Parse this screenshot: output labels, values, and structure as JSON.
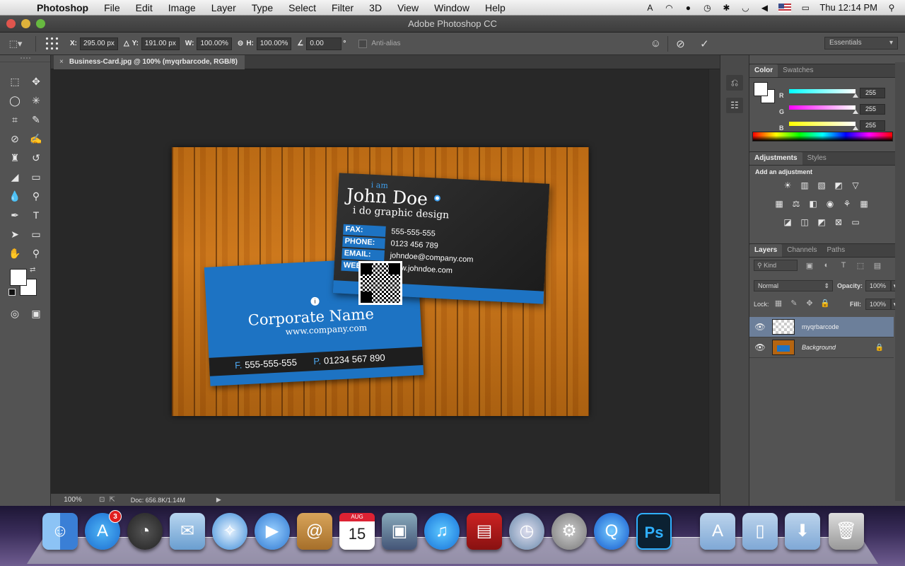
{
  "menubar": {
    "app": "Photoshop",
    "items": [
      "File",
      "Edit",
      "Image",
      "Layer",
      "Type",
      "Select",
      "Filter",
      "3D",
      "View",
      "Window",
      "Help"
    ],
    "clock": "Thu 12:14 PM"
  },
  "window": {
    "title": "Adobe Photoshop CC"
  },
  "options": {
    "x_label": "X:",
    "x_value": "295.00 px",
    "y_label": "Y:",
    "y_value": "191.00 px",
    "w_label": "W:",
    "w_value": "100.00%",
    "h_label": "H:",
    "h_value": "100.00%",
    "angle_value": "0.00",
    "degree": "°",
    "antialias": "Anti-alias",
    "workspace": "Essentials"
  },
  "document": {
    "tab": "Business-Card.jpg @ 100% (myqrbarcode, RGB/8)",
    "zoom": "100%",
    "doc_size": "Doc: 656.8K/1.14M"
  },
  "card_dark": {
    "iam": "i am",
    "name": "John Doe",
    "subtitle": "i do graphic design",
    "rows": [
      {
        "label": "FAX:",
        "value": "555-555-555"
      },
      {
        "label": "PHONE:",
        "value": "0123 456 789"
      },
      {
        "label": "EMAIL:",
        "value": "johndoe@company.com"
      },
      {
        "label": "WEB:",
        "value": "www.johndoe.com"
      }
    ]
  },
  "card_blue": {
    "info": "i",
    "name": "Corporate Name",
    "url": "www.company.com",
    "fax_key": "F.",
    "fax": "555-555-555",
    "phone_key": "P.",
    "phone": "01234 567 890"
  },
  "color_panel": {
    "tabs": [
      "Color",
      "Swatches"
    ],
    "r_label": "R",
    "r": "255",
    "g_label": "G",
    "g": "255",
    "b_label": "B",
    "b": "255"
  },
  "adjust_panel": {
    "tabs": [
      "Adjustments",
      "Styles"
    ],
    "title": "Add an adjustment"
  },
  "layers_panel": {
    "tabs": [
      "Layers",
      "Channels",
      "Paths"
    ],
    "kind": "Kind",
    "blend": "Normal",
    "opacity_label": "Opacity:",
    "opacity": "100%",
    "lock_label": "Lock:",
    "fill_label": "Fill:",
    "fill": "100%",
    "layers": [
      {
        "name": "myqrbarcode"
      },
      {
        "name": "Background"
      }
    ]
  },
  "dock": {
    "appstore_badge": "3",
    "calendar_month": "AUG",
    "calendar_day": "15",
    "ps_label": "Ps"
  },
  "colors": {
    "accent_blue": "#1d73c3",
    "selected_layer": "#6c7f9a"
  }
}
